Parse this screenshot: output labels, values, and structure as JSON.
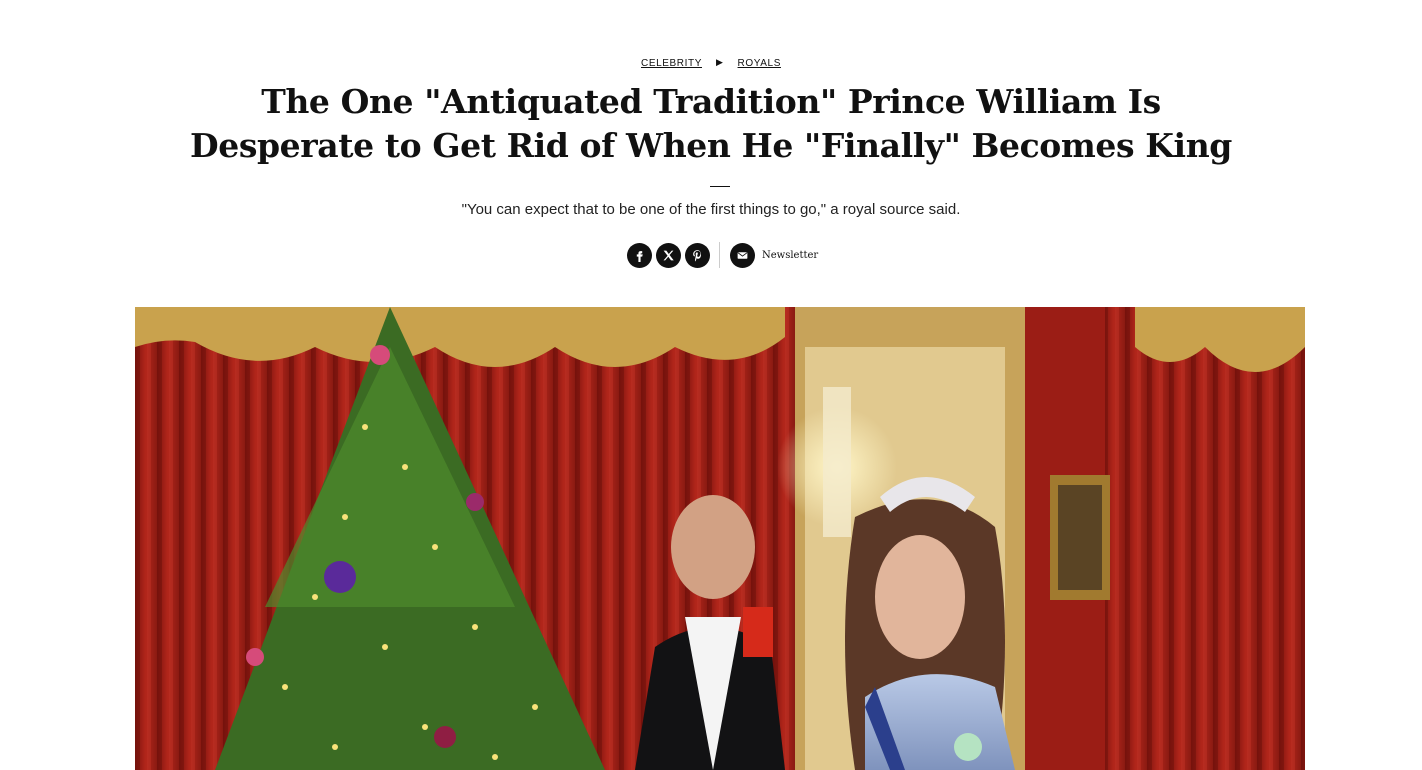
{
  "breadcrumb": {
    "items": [
      "CELEBRITY",
      "ROYALS"
    ]
  },
  "article": {
    "title_line1": "The One \"Antiquated Tradition\" Prince William Is",
    "title_line2": "Desperate to Get Rid of When He \"Finally\" Becomes King",
    "dek": "\"You can expect that to be one of the first things to go,\" a royal source said."
  },
  "share": {
    "icons": [
      "facebook-icon",
      "x-icon",
      "pinterest-icon",
      "mail-icon"
    ],
    "newsletter_label": "Newsletter"
  },
  "hero": {
    "colors": {
      "curtain": "#9e1f17",
      "gold": "#c9a24d",
      "tree": "#3b6b23"
    }
  }
}
